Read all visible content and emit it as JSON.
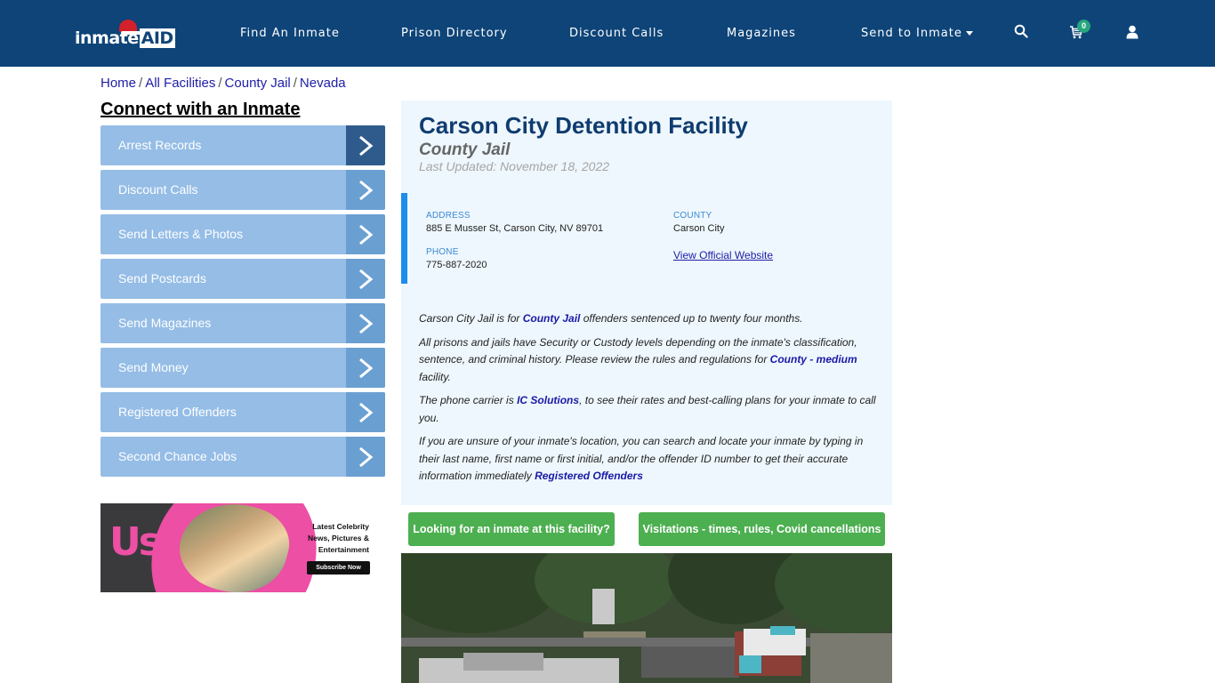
{
  "header": {
    "logo": {
      "text": "inmate",
      "accent": "AID"
    },
    "nav": [
      {
        "label": "Find An Inmate"
      },
      {
        "label": "Prison Directory"
      },
      {
        "label": "Discount Calls"
      },
      {
        "label": "Magazines"
      },
      {
        "label": "Send to Inmate",
        "has_dropdown": true
      }
    ],
    "icons": [
      "search-icon",
      "cart-icon",
      "user-icon"
    ],
    "cart_count": "0"
  },
  "breadcrumb": [
    {
      "label": "Home"
    },
    {
      "label": "All Facilities"
    },
    {
      "label": "County Jail"
    },
    {
      "label": "Nevada"
    }
  ],
  "breadcrumb_separator": "/",
  "sidebar": {
    "title": "Connect with an Inmate",
    "items": [
      {
        "label": "Arrest Records",
        "active": true
      },
      {
        "label": "Discount Calls"
      },
      {
        "label": "Send Letters & Photos"
      },
      {
        "label": "Send Postcards"
      },
      {
        "label": "Send Magazines"
      },
      {
        "label": "Send Money"
      },
      {
        "label": "Registered Offenders"
      },
      {
        "label": "Second Chance Jobs"
      }
    ],
    "ad": {
      "brand": "Us",
      "lines": [
        "Latest Celebrity",
        "News, Pictures &",
        "Entertainment"
      ],
      "cta": "Subscribe Now"
    }
  },
  "facility": {
    "name": "Carson City Detention Facility",
    "type": "County Jail",
    "last_updated": "Last Updated: November 18, 2022",
    "address_label": "ADDRESS",
    "address": "885 E Musser St, Carson City, NV 89701",
    "county_label": "COUNTY",
    "county": "Carson City",
    "phone_label": "PHONE",
    "phone": "775-887-2020",
    "website_link": "View Official Website"
  },
  "description": {
    "p1_a": "Carson City Jail is for ",
    "p1_link": "County Jail",
    "p1_b": " offenders sentenced up to twenty four months.",
    "p2_a": "All prisons and jails have Security or Custody levels depending on the inmate's classification, sentence, and criminal history. Please review the rules and regulations for ",
    "p2_link": "County - medium",
    "p2_b": " facility.",
    "p3_a": "The phone carrier is ",
    "p3_link": "IC Solutions",
    "p3_b": ", to see their rates and best-calling plans for your inmate to call you.",
    "p4_a": "If you are unsure of your inmate's location, you can search and locate your inmate by typing in their last name, first name or first initial, and/or the offender ID number to get their accurate information immediately ",
    "p4_link": "Registered Offenders"
  },
  "actions": {
    "find_inmate": "Looking for an inmate at this facility?",
    "visitations": "Visitations - times, rules, Covid cancellations"
  },
  "colors": {
    "header_bg": "#0e4478",
    "sidebar_item": "#95bde6",
    "sidebar_arrow": "#6a9fd2",
    "sidebar_arrow_active": "#2f5b8c",
    "card_bg": "#eef7fd",
    "accent_bar": "#1d8ded",
    "title": "#0f3c70",
    "button_green": "#4caf50",
    "link": "#1a1aa6",
    "cart_badge": "#26a67d"
  }
}
